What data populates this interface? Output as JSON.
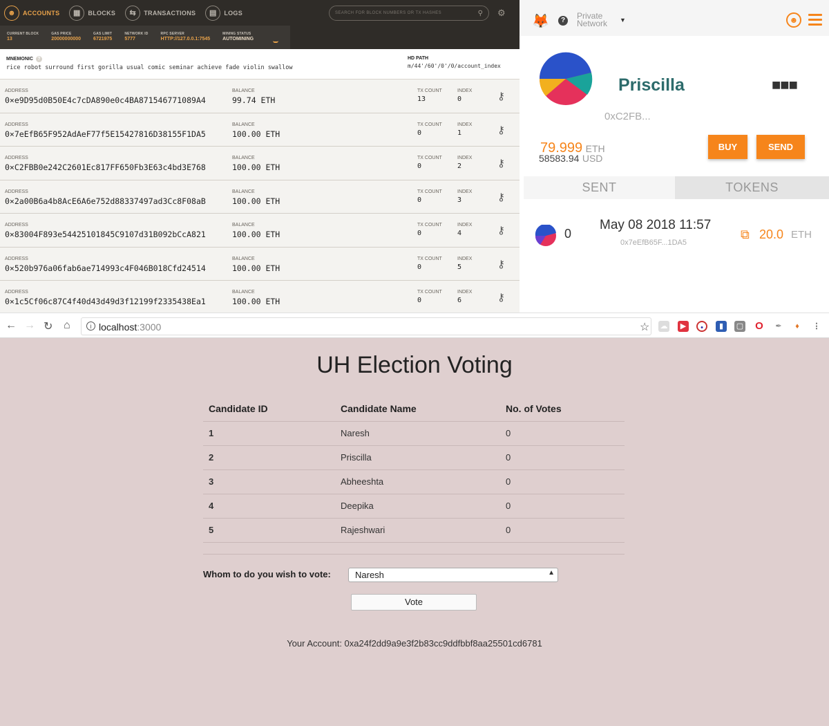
{
  "ganache": {
    "tabs": [
      {
        "label": "ACCOUNTS",
        "icon": "person-icon"
      },
      {
        "label": "BLOCKS",
        "icon": "grid-icon"
      },
      {
        "label": "TRANSACTIONS",
        "icon": "swap-icon"
      },
      {
        "label": "LOGS",
        "icon": "logs-icon"
      }
    ],
    "search_placeholder": "SEARCH FOR BLOCK NUMBERS OR TX HASHES",
    "status": [
      {
        "label": "CURRENT BLOCK",
        "value": "13"
      },
      {
        "label": "GAS PRICE",
        "value": "20000000000"
      },
      {
        "label": "GAS LIMIT",
        "value": "6721975"
      },
      {
        "label": "NETWORK ID",
        "value": "5777"
      },
      {
        "label": "RPC SERVER",
        "value": "HTTP://127.0.0.1:7545"
      },
      {
        "label": "MINING STATUS",
        "value": "AUTOMINING"
      }
    ],
    "mnemonic_label": "MNEMONIC",
    "mnemonic": "rice robot surround first gorilla usual comic seminar achieve fade violin swallow",
    "hd_path_label": "HD PATH",
    "hd_path": "m/44'/60'/0'/0/account_index",
    "col_labels": {
      "address": "ADDRESS",
      "balance": "BALANCE",
      "tx": "TX COUNT",
      "index": "INDEX"
    },
    "accounts": [
      {
        "address": "0×e9D95d0B50E4c7cDA890e0c4BA871546771089A4",
        "balance": "99.74 ETH",
        "tx": "13",
        "index": "0"
      },
      {
        "address": "0×7eEfB65F952AdAeF77f5E15427816D38155F1DA5",
        "balance": "100.00 ETH",
        "tx": "0",
        "index": "1"
      },
      {
        "address": "0×C2FBB0e242C2601Ec817FF650Fb3E63c4bd3E768",
        "balance": "100.00 ETH",
        "tx": "0",
        "index": "2"
      },
      {
        "address": "0×2a00B6a4b8AcE6A6e752d88337497ad3Cc8F08aB",
        "balance": "100.00 ETH",
        "tx": "0",
        "index": "3"
      },
      {
        "address": "0×83004F893e54425101845C9107d31B092bCcA821",
        "balance": "100.00 ETH",
        "tx": "0",
        "index": "4"
      },
      {
        "address": "0×520b976a06fab6ae714993c4F046B018Cfd24514",
        "balance": "100.00 ETH",
        "tx": "0",
        "index": "5"
      },
      {
        "address": "0×1c5Cf06c87C4f40d43d49d3f12199f2335438Ea1",
        "balance": "100.00 ETH",
        "tx": "0",
        "index": "6"
      }
    ],
    "colors": {
      "accent": "#e8a24a",
      "nav_bg": "#2f2c28"
    }
  },
  "metamask": {
    "network_line1": "Private",
    "network_line2": "Network",
    "account_name": "Priscilla",
    "address_short": "0xC2FB...",
    "eth_balance": "79.999",
    "eth_unit": "ETH",
    "usd_balance": "58583.94",
    "usd_unit": "USD",
    "buy_label": "BUY",
    "send_label": "SEND",
    "tab_sent": "SENT",
    "tab_tokens": "TOKENS",
    "tx": {
      "nonce": "0",
      "date": "May 08 2018 11:57",
      "to": "0x7eEfB65F...1DA5",
      "amount": "20.0",
      "unit": "ETH"
    },
    "colors": {
      "accent": "#f6851b",
      "name": "#2c6b6b"
    }
  },
  "browser": {
    "url_host": "localhost",
    "url_port": ":3000",
    "extensions": [
      "cloud-icon",
      "media-icon",
      "circle-ext-icon",
      "bookmark-ext-icon",
      "square-ext-icon",
      "opera-icon",
      "eyedropper-icon",
      "metamask-fox-icon",
      "more-vert-icon"
    ]
  },
  "app": {
    "title": "UH Election Voting",
    "columns": [
      "Candidate ID",
      "Candidate Name",
      "No. of Votes"
    ],
    "candidates": [
      {
        "id": "1",
        "name": "Naresh",
        "votes": "0"
      },
      {
        "id": "2",
        "name": "Priscilla",
        "votes": "0"
      },
      {
        "id": "3",
        "name": "Abheeshta",
        "votes": "0"
      },
      {
        "id": "4",
        "name": "Deepika",
        "votes": "0"
      },
      {
        "id": "5",
        "name": "Rajeshwari",
        "votes": "0"
      }
    ],
    "vote_label": "Whom to do you wish to vote:",
    "selected_candidate": "Naresh",
    "vote_button": "Vote",
    "account_line": "Your Account: 0xa24f2dd9a9e3f2b83cc9ddfbbf8aa25501cd6781",
    "colors": {
      "background": "#dfcfcf"
    }
  }
}
